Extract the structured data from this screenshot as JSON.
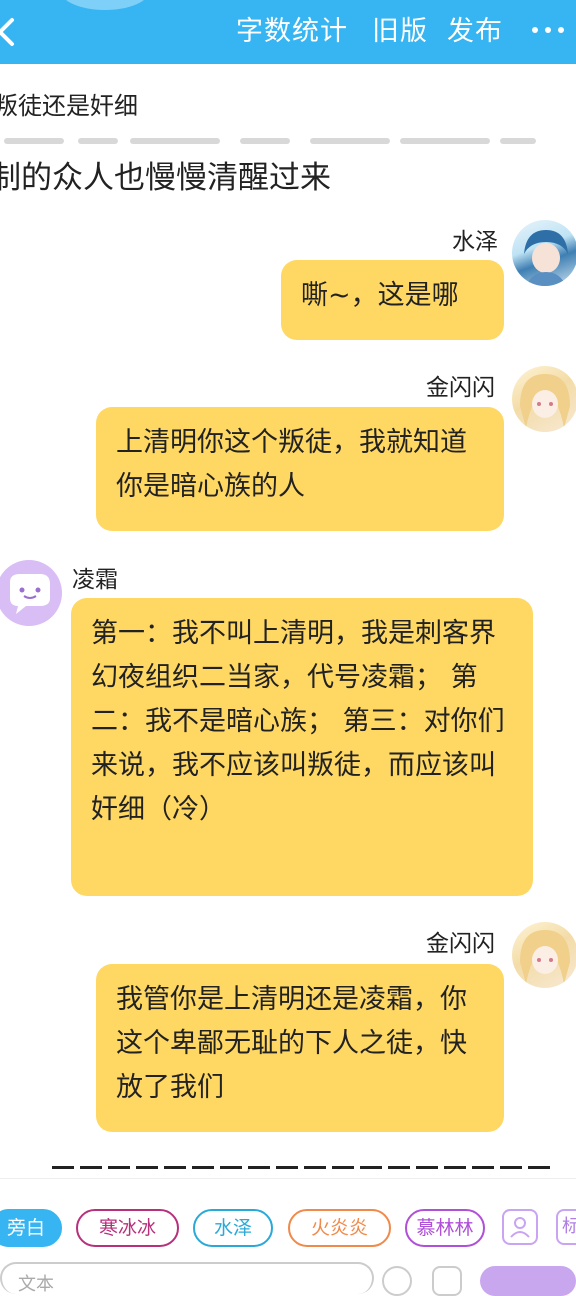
{
  "topbar": {
    "word_count": "字数统计",
    "old_version": "旧版",
    "publish": "发布",
    "more_icon": "more-dots-icon",
    "back_icon": "chevron-left-icon"
  },
  "story": {
    "line1": "叛徒还是奸细",
    "line2": "制的众人也慢慢清醒过来"
  },
  "messages": [
    {
      "speaker": "水泽",
      "text": "嘶~，这是哪"
    },
    {
      "speaker": "金闪闪",
      "text": "上清明你这个叛徒，我就知道你是暗心族的人"
    },
    {
      "speaker": "凌霜",
      "text": "第一：我不叫上清明，我是刺客界幻夜组织二当家，代号凌霜； 第二：我不是暗心族； 第三：对你们来说，我不应该叫叛徒，而应该叫奸细（冷）"
    },
    {
      "speaker": "金闪闪",
      "text": "我管你是上清明还是凌霜，你这个卑鄙无耻的下人之徒，快放了我们"
    }
  ],
  "chips": [
    {
      "label": "旁白",
      "color": "#36b5f2",
      "filled": true
    },
    {
      "label": "寒冰冰",
      "color": "#b8307c",
      "filled": false
    },
    {
      "label": "水泽",
      "color": "#2aa9d8",
      "filled": false
    },
    {
      "label": "火炎炎",
      "color": "#f08a4b",
      "filled": false
    },
    {
      "label": "慕林林",
      "color": "#b04fd8",
      "filled": false
    }
  ],
  "chip_icons": [
    "add-character-icon",
    "label-icon"
  ],
  "chip_icon_label": "标",
  "input": {
    "placeholder": "文本"
  },
  "colors": {
    "accent": "#36b5f2",
    "bubble": "#ffd863"
  }
}
